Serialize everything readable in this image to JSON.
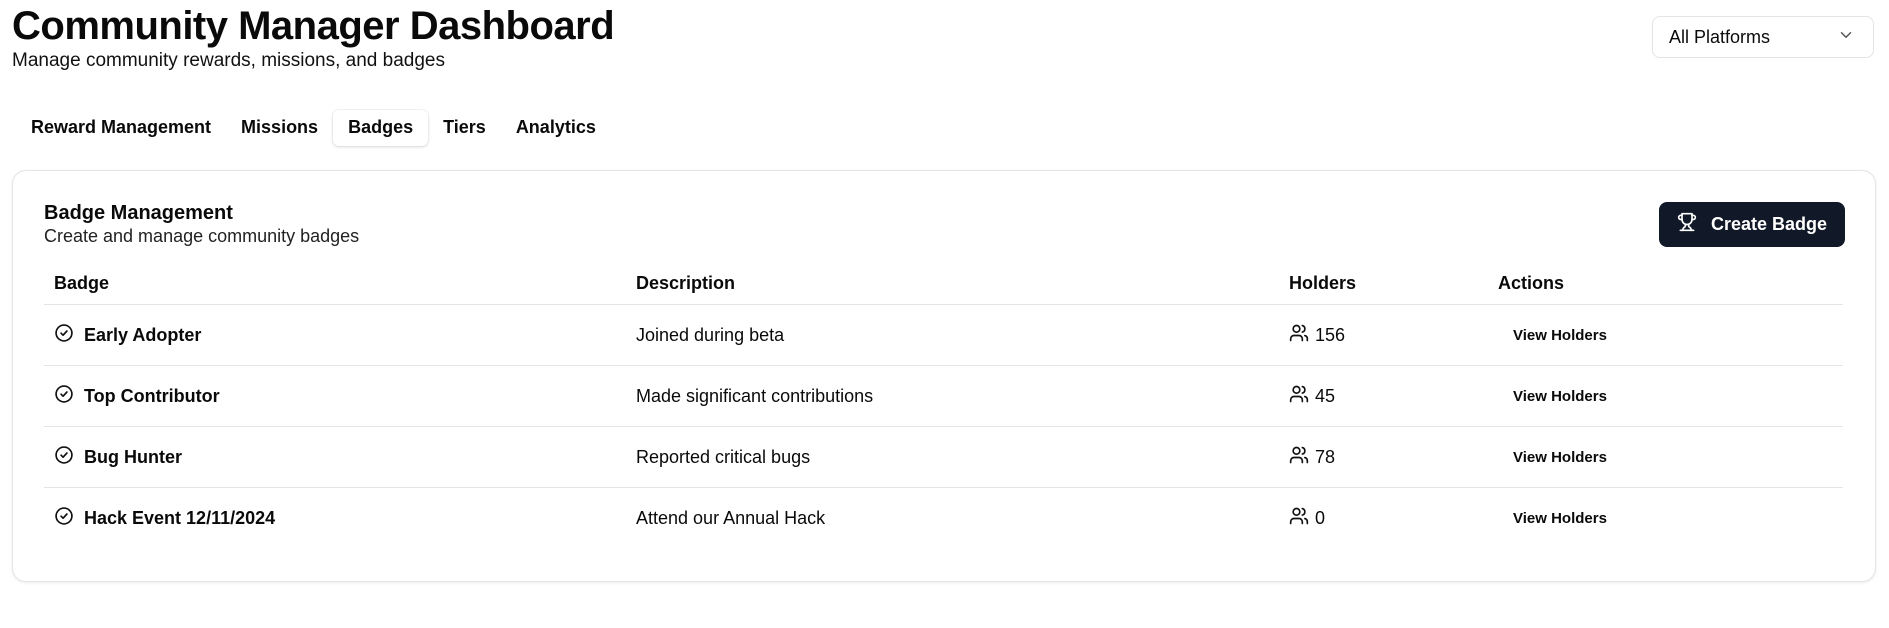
{
  "header": {
    "title": "Community Manager Dashboard",
    "subtitle": "Manage community rewards, missions, and badges"
  },
  "platform_select": {
    "value": "All Platforms",
    "icon": "chevron-down-icon"
  },
  "tabs": [
    {
      "label": "Reward Management",
      "active": false
    },
    {
      "label": "Missions",
      "active": false
    },
    {
      "label": "Badges",
      "active": true
    },
    {
      "label": "Tiers",
      "active": false
    },
    {
      "label": "Analytics",
      "active": false
    }
  ],
  "card": {
    "title": "Badge Management",
    "description": "Create and manage community badges",
    "create_button": {
      "label": "Create Badge",
      "icon": "trophy-icon"
    }
  },
  "table": {
    "columns": [
      "Badge",
      "Description",
      "Holders",
      "Actions"
    ],
    "rows": [
      {
        "badge": "Early Adopter",
        "description": "Joined during beta",
        "holders": "156",
        "action": "View Holders"
      },
      {
        "badge": "Top Contributor",
        "description": "Made significant contributions",
        "holders": "45",
        "action": "View Holders"
      },
      {
        "badge": "Bug Hunter",
        "description": "Reported critical bugs",
        "holders": "78",
        "action": "View Holders"
      },
      {
        "badge": "Hack Event 12/11/2024",
        "description": "Attend our Annual Hack",
        "holders": "0",
        "action": "View Holders"
      }
    ]
  },
  "colors": {
    "primary_button": "#111827",
    "border": "#e4e4e7",
    "text": "#0a0a0a"
  }
}
